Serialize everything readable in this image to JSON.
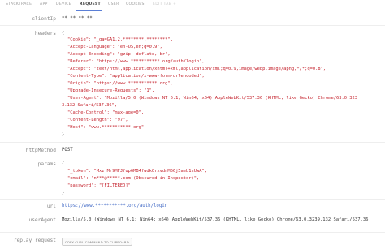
{
  "tabs": [
    {
      "label": "STACKTRACE"
    },
    {
      "label": "APP"
    },
    {
      "label": "DEVICE"
    },
    {
      "label": "REQUEST"
    },
    {
      "label": "USER"
    },
    {
      "label": "COOKIES"
    },
    {
      "label": "EDIT TAB +"
    }
  ],
  "active_tab": "REQUEST",
  "clientIp": {
    "label": "clientIp",
    "value": "**.**.**.**"
  },
  "headers": {
    "label": "headers",
    "open": "{",
    "close": "}",
    "lines": [
      "\"Cookie\": \"_ga=GA1.2.********.********\",",
      "\"Accept-Language\": \"en-US,en;q=0.9\",",
      "\"Accept-Encoding\": \"gzip, deflate, br\",",
      "\"Referer\": \"https://www.***********.org/auth/login\",",
      "\"Accept\": \"text/html,application/xhtml+xml,application/xml;q=0.9,image/webp,image/apng,*/*;q=0.8\",",
      "\"Content-Type\": \"application/x-www-form-urlencoded\",",
      "\"Origin\": \"https://www.***********.org\",",
      "\"Upgrade-Insecure-Requests\": \"1\",",
      "\"User-Agent\": \"Mozilla/5.0 (Windows NT 6.1; Win64; x64) AppleWebKit/537.36 (KHTML, like Gecko) Chrome/63.0.323",
      "3.132 Safari/537.36\",",
      "\"Cache-Control\": \"max-age=0\",",
      "\"Content-Length\": \"97\",",
      "\"Host\": \"www.***********.org\""
    ]
  },
  "httpMethod": {
    "label": "httpMethod",
    "value": "POST"
  },
  "params": {
    "label": "params",
    "open": "{",
    "close": "}",
    "lines": [
      "\"_token\": \"Mxz Mr9MFJfup6MB4fwdkOrxvdnM66j5aeb1sUwA\",",
      "\"email\": \"n***@*****.com (Obscured in Inspector)\",",
      "\"password\": \"[FILTERED]\""
    ]
  },
  "url": {
    "label": "url",
    "value": "https://www.***********.org/auth/login"
  },
  "userAgent": {
    "label": "userAgent",
    "value": "Mozilla/5.0 (Windows NT 6.1; Win64; x64) AppleWebKit/537.36 (KHTML, like Gecko) Chrome/63.0.3239.132 Safari/537.36"
  },
  "replay": {
    "label": "replay request",
    "button_label": "COPY CURL COMMAND TO CLIPBOARD"
  },
  "colors": {
    "accent": "#5b7fd6",
    "string": "#c4222c",
    "link": "#4169c5"
  }
}
